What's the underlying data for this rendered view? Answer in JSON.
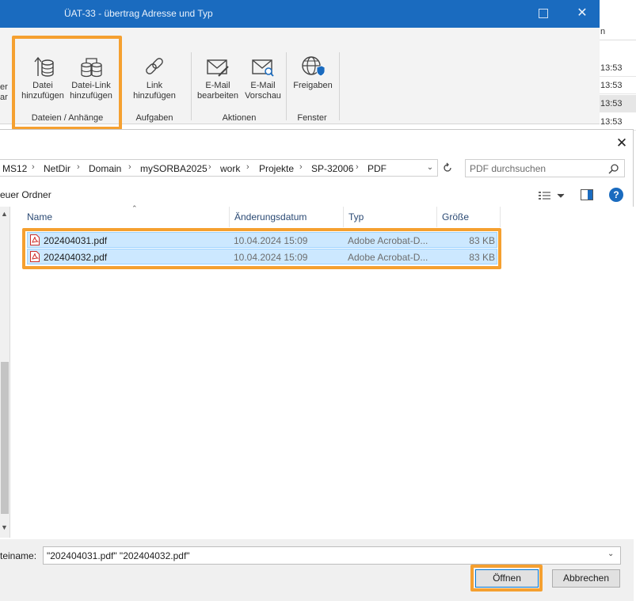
{
  "window": {
    "title": "ÜAT-33 - übertrag Adresse und Typ",
    "close_glyph": "✕"
  },
  "ribbon": {
    "partial_left": [
      "er",
      "ar"
    ],
    "buttons": {
      "add_file": [
        "Datei",
        "hinzufügen"
      ],
      "add_file_link": [
        "Datei-Link",
        "hinzufügen"
      ],
      "add_link": "Link hinzufügen",
      "edit_email": [
        "E-Mail",
        "bearbeiten"
      ],
      "email_preview": [
        "E-Mail",
        "Vorschau"
      ],
      "shares": "Freigaben"
    },
    "groups": {
      "files": "Dateien / Anhänge",
      "tasks": "Aufgaben",
      "actions": "Aktionen",
      "window": "Fenster"
    },
    "highlight_color": "#f5a030"
  },
  "background_list": {
    "header_fragment": "n",
    "times": [
      "13:53",
      "13:53",
      "13:53",
      "13:53"
    ]
  },
  "dialog": {
    "close_glyph": "✕",
    "breadcrumb": [
      "MS12",
      "NetDir",
      "Domain",
      "mySORBA2025",
      "work",
      "Projekte",
      "SP-32006",
      "PDF"
    ],
    "breadcrumb_separator": "›",
    "search_placeholder": "PDF durchsuchen",
    "new_folder_label": "euer Ordner",
    "help_glyph": "?",
    "columns": {
      "name": "Name",
      "modified": "Änderungsdatum",
      "type": "Typ",
      "size": "Größe"
    },
    "files": [
      {
        "name": "202404031.pdf",
        "modified": "10.04.2024 15:09",
        "type": "Adobe Acrobat-D...",
        "size": "83 KB",
        "selected": true
      },
      {
        "name": "202404032.pdf",
        "modified": "10.04.2024 15:09",
        "type": "Adobe Acrobat-D...",
        "size": "83 KB",
        "selected": true
      }
    ],
    "filename_label": "teiname:",
    "filename_value": "\"202404031.pdf\" \"202404032.pdf\"",
    "open_label": "Öffnen",
    "cancel_label": "Abbrechen"
  },
  "colors": {
    "titlebar": "#1a6bbf",
    "selection": "#cce8ff",
    "accent": "#0078d7",
    "highlight": "#f5a030"
  }
}
